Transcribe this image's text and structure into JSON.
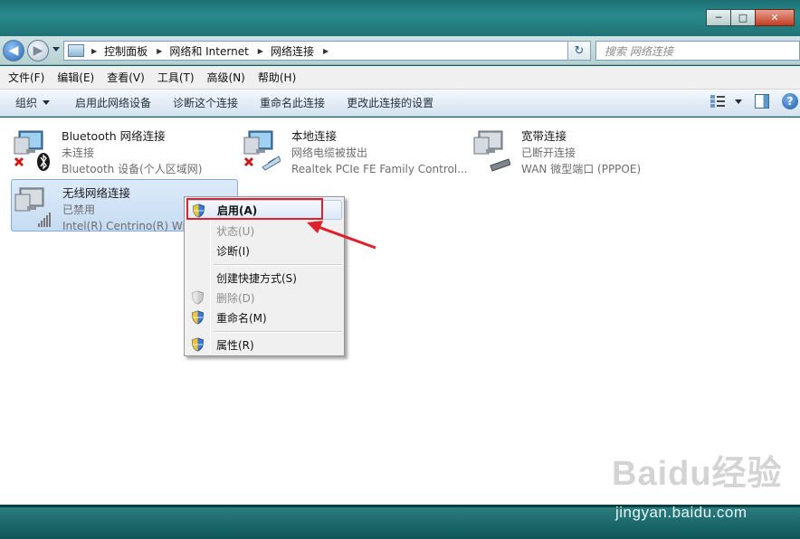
{
  "window": {
    "minimize_glyph": "─",
    "maximize_glyph": "□",
    "close_glyph": "✕"
  },
  "nav": {
    "back_glyph": "◀",
    "forward_glyph": "▶",
    "breadcrumbs": [
      "控制面板",
      "网络和 Internet",
      "网络连接"
    ],
    "crumb_separator": "▶",
    "refresh_glyph": "↻",
    "search_placeholder": "搜索 网络连接"
  },
  "menubar": [
    "文件(F)",
    "编辑(E)",
    "查看(V)",
    "工具(T)",
    "高级(N)",
    "帮助(H)"
  ],
  "toolbar": {
    "organize": "组织",
    "items": [
      "启用此网络设备",
      "诊断这个连接",
      "重命名此连接",
      "更改此连接的设置"
    ],
    "help_glyph": "?"
  },
  "connections": [
    {
      "name": "Bluetooth 网络连接",
      "status": "未连接",
      "device": "Bluetooth 设备(个人区域网)",
      "icon": "bluetooth-network-icon",
      "state": "disconnected"
    },
    {
      "name": "本地连接",
      "status": "网络电缆被拔出",
      "device": "Realtek PCIe FE Family Control...",
      "icon": "lan-network-icon",
      "state": "disconnected"
    },
    {
      "name": "宽带连接",
      "status": "已断开连接",
      "device": "WAN 微型端口 (PPPOE)",
      "icon": "broadband-network-icon",
      "state": "disconnected"
    },
    {
      "name": "无线网络连接",
      "status": "已禁用",
      "device": "Intel(R) Centrino(R) Wir",
      "icon": "wireless-network-icon",
      "state": "disabled"
    }
  ],
  "context_menu": [
    {
      "label": "启用(A)",
      "shield": true,
      "disabled": false,
      "bold": true
    },
    {
      "label": "状态(U)",
      "shield": false,
      "disabled": true,
      "bold": false
    },
    {
      "label": "诊断(I)",
      "shield": false,
      "disabled": false,
      "bold": false
    },
    {
      "label": "创建快捷方式(S)",
      "shield": false,
      "disabled": false,
      "bold": false
    },
    {
      "label": "删除(D)",
      "shield": true,
      "disabled": true,
      "bold": false
    },
    {
      "label": "重命名(M)",
      "shield": true,
      "disabled": false,
      "bold": false
    },
    {
      "label": "属性(R)",
      "shield": true,
      "disabled": false,
      "bold": false
    }
  ],
  "watermark": {
    "logo": "Baidu经验",
    "url": "jingyan.baidu.com"
  },
  "colors": {
    "annotation_red": "#e0202a",
    "selection_blue": "#c6dcf3",
    "window_frame": "#1f7375"
  }
}
